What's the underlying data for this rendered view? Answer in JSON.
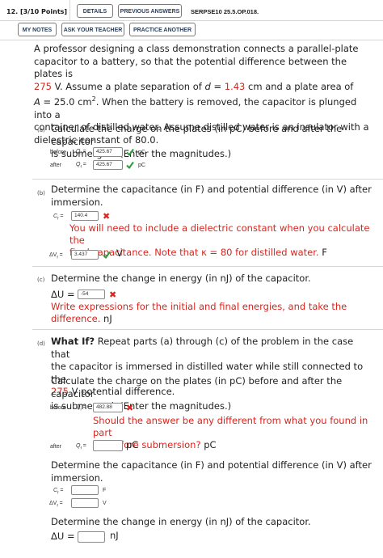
{
  "header": {
    "question_number": "12.",
    "points": "[3/10 Points]",
    "details_label": "DETAILS",
    "previous_answers_label": "PREVIOUS ANSWERS",
    "problem_id": "SERPSE10 25.5.OP.018.",
    "my_notes_label": "MY NOTES",
    "ask_teacher_label": "ASK YOUR TEACHER",
    "practice_another_label": "PRACTICE ANOTHER"
  },
  "problem": {
    "line1": "A professor designing a class demonstration connects a parallel-plate",
    "line2": "capacitor to a battery, so that the potential difference between the plates is",
    "voltage": "275",
    "line3_after_voltage": " V. Assume a plate separation of ",
    "d_label": "d",
    "eq": " = ",
    "separation": "1.43",
    "line3_end": " cm and a plate area of",
    "area_label": "A",
    "area_value": " = 25.0 cm",
    "area_exp": "2",
    "line4_end": ". When the battery is removed, the capacitor is plunged into a",
    "line5": "container of distilled water. Assume distilled water is an insulator with a",
    "line6": "dielectric constant of 80.0."
  },
  "part_a": {
    "label": "(a)",
    "text1": "Calculate the charge on the plates (in pC) before and after the capacitor",
    "text2": "is submerged. (Enter the magnitudes.)",
    "before_label": "before",
    "after_label": "after",
    "qi_symbol": "Q",
    "qi_sub": "i",
    "qf_symbol": "Q",
    "qf_sub": "f",
    "equals": "=",
    "before_value": "425.67",
    "after_value": "425.67",
    "unit": "pC"
  },
  "part_b": {
    "label": "(b)",
    "text1": "Determine the capacitance (in F) and potential difference (in V) after",
    "text2": "immersion.",
    "cf_symbol": "C",
    "cf_sub": "f",
    "cf_value": "140.4",
    "feedback1": "You will need to include a dielectric constant when you calculate the",
    "feedback2": "final capacitance. Note that κ = 80 for distilled water.",
    "cf_unit": "F",
    "dv_symbol": "ΔV",
    "dv_sub": "f",
    "dv_value": "3.437",
    "dv_unit": "V"
  },
  "part_c": {
    "label": "(c)",
    "text1": "Determine the change in energy (in nJ) of the capacitor.",
    "du_symbol": "ΔU",
    "equals": "=",
    "du_value": "-54",
    "feedback1": "Write expressions for the initial and final energies, and take the",
    "feedback2": "difference.",
    "du_unit": "nJ"
  },
  "part_d": {
    "label": "(d)",
    "what_if": "What If?",
    "text1": " Repeat parts (a) through (c) of the problem in the case that",
    "text2": "the capacitor is immersed in distilled water while still connected to the",
    "voltage": "275",
    "text3_end": " V potential difference.",
    "sub1_text1": "Calculate the charge on the plates (in pC) before and after the capacitor",
    "sub1_text2": "is submerged. (Enter the magnitudes.)",
    "before_label": "before",
    "before_value": "482.88",
    "feedback1": "Should the answer be any different from what you found in part",
    "feedback2": "(a) before submersion?",
    "pc_unit": "pC",
    "after_label": "after",
    "after_value": "",
    "sub2_text1": "Determine the capacitance (in F) and potential difference (in V) after",
    "sub2_text2": "immersion.",
    "cf_value": "",
    "cf_unit": "F",
    "dv_value": "",
    "dv_unit": "V",
    "sub3_text": "Determine the change in energy (in nJ) of the capacitor.",
    "du_value": "",
    "du_unit": "nJ"
  },
  "colors": {
    "accent_red": "#d8261f",
    "check_green": "#2e9b3a",
    "button_text": "#2c3f5a"
  }
}
